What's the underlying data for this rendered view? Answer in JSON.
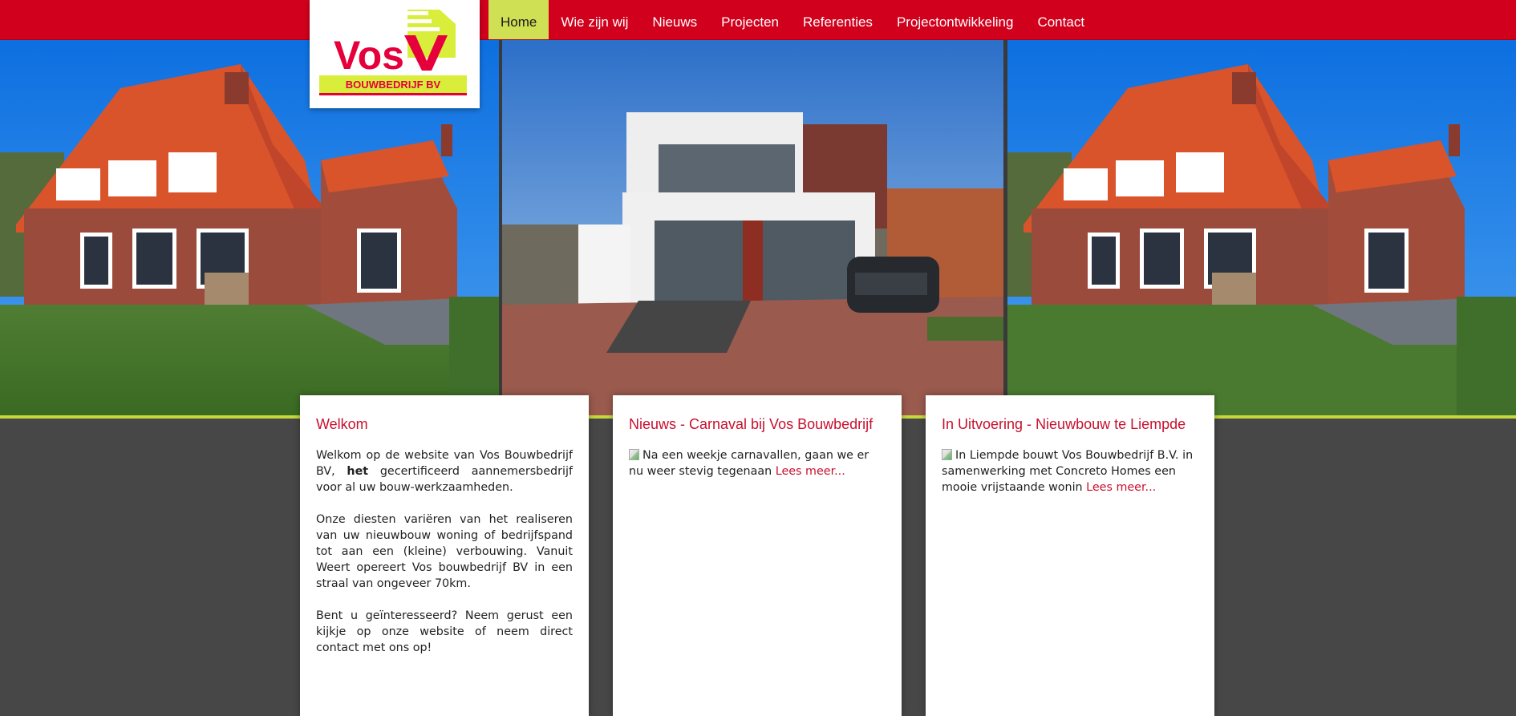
{
  "logo": {
    "brand": "Vos",
    "subtitle": "BOUWBEDRIJF BV"
  },
  "nav": {
    "items": [
      {
        "label": "Home",
        "active": true
      },
      {
        "label": "Wie zijn wij",
        "active": false
      },
      {
        "label": "Nieuws",
        "active": false
      },
      {
        "label": "Projecten",
        "active": false
      },
      {
        "label": "Referenties",
        "active": false
      },
      {
        "label": "Projectontwikkeling",
        "active": false
      },
      {
        "label": "Contact",
        "active": false
      }
    ]
  },
  "colors": {
    "brand_red": "#d1001c",
    "accent_lime": "#cfe055",
    "background": "#474747",
    "heading_red": "#c8102e"
  },
  "cards": {
    "welkom": {
      "title": "Welkom",
      "p1_prefix": "Welkom op de website van Vos Bouwbedrijf BV, ",
      "p1_bold": "het",
      "p1_suffix": " gecertificeerd aannemersbedrijf voor al uw bouw-werkzaamheden.",
      "p2": "Onze diesten variëren van het realiseren van uw nieuwbouw woning of bedrijfspand tot aan een (kleine) verbouwing. Vanuit Weert opereert Vos bouwbedrijf BV in een straal van ongeveer 70km.",
      "p3": "Bent u geïnteresseerd? Neem gerust een kijkje op onze website of neem direct contact met ons op!"
    },
    "nieuws": {
      "title": "Nieuws - Carnaval bij Vos Bouwbedrijf",
      "text": "Na een weekje carnavallen, gaan we er nu weer stevig tegenaan",
      "link": "Lees meer..."
    },
    "uitvoering": {
      "title": "In Uitvoering - Nieuwbouw te Liempde",
      "text": "In Liempde bouwt Vos Bouwbedrijf B.V. in samenwerking met Concreto Homes een mooie vrijstaande wonin",
      "link": "Lees meer..."
    }
  }
}
